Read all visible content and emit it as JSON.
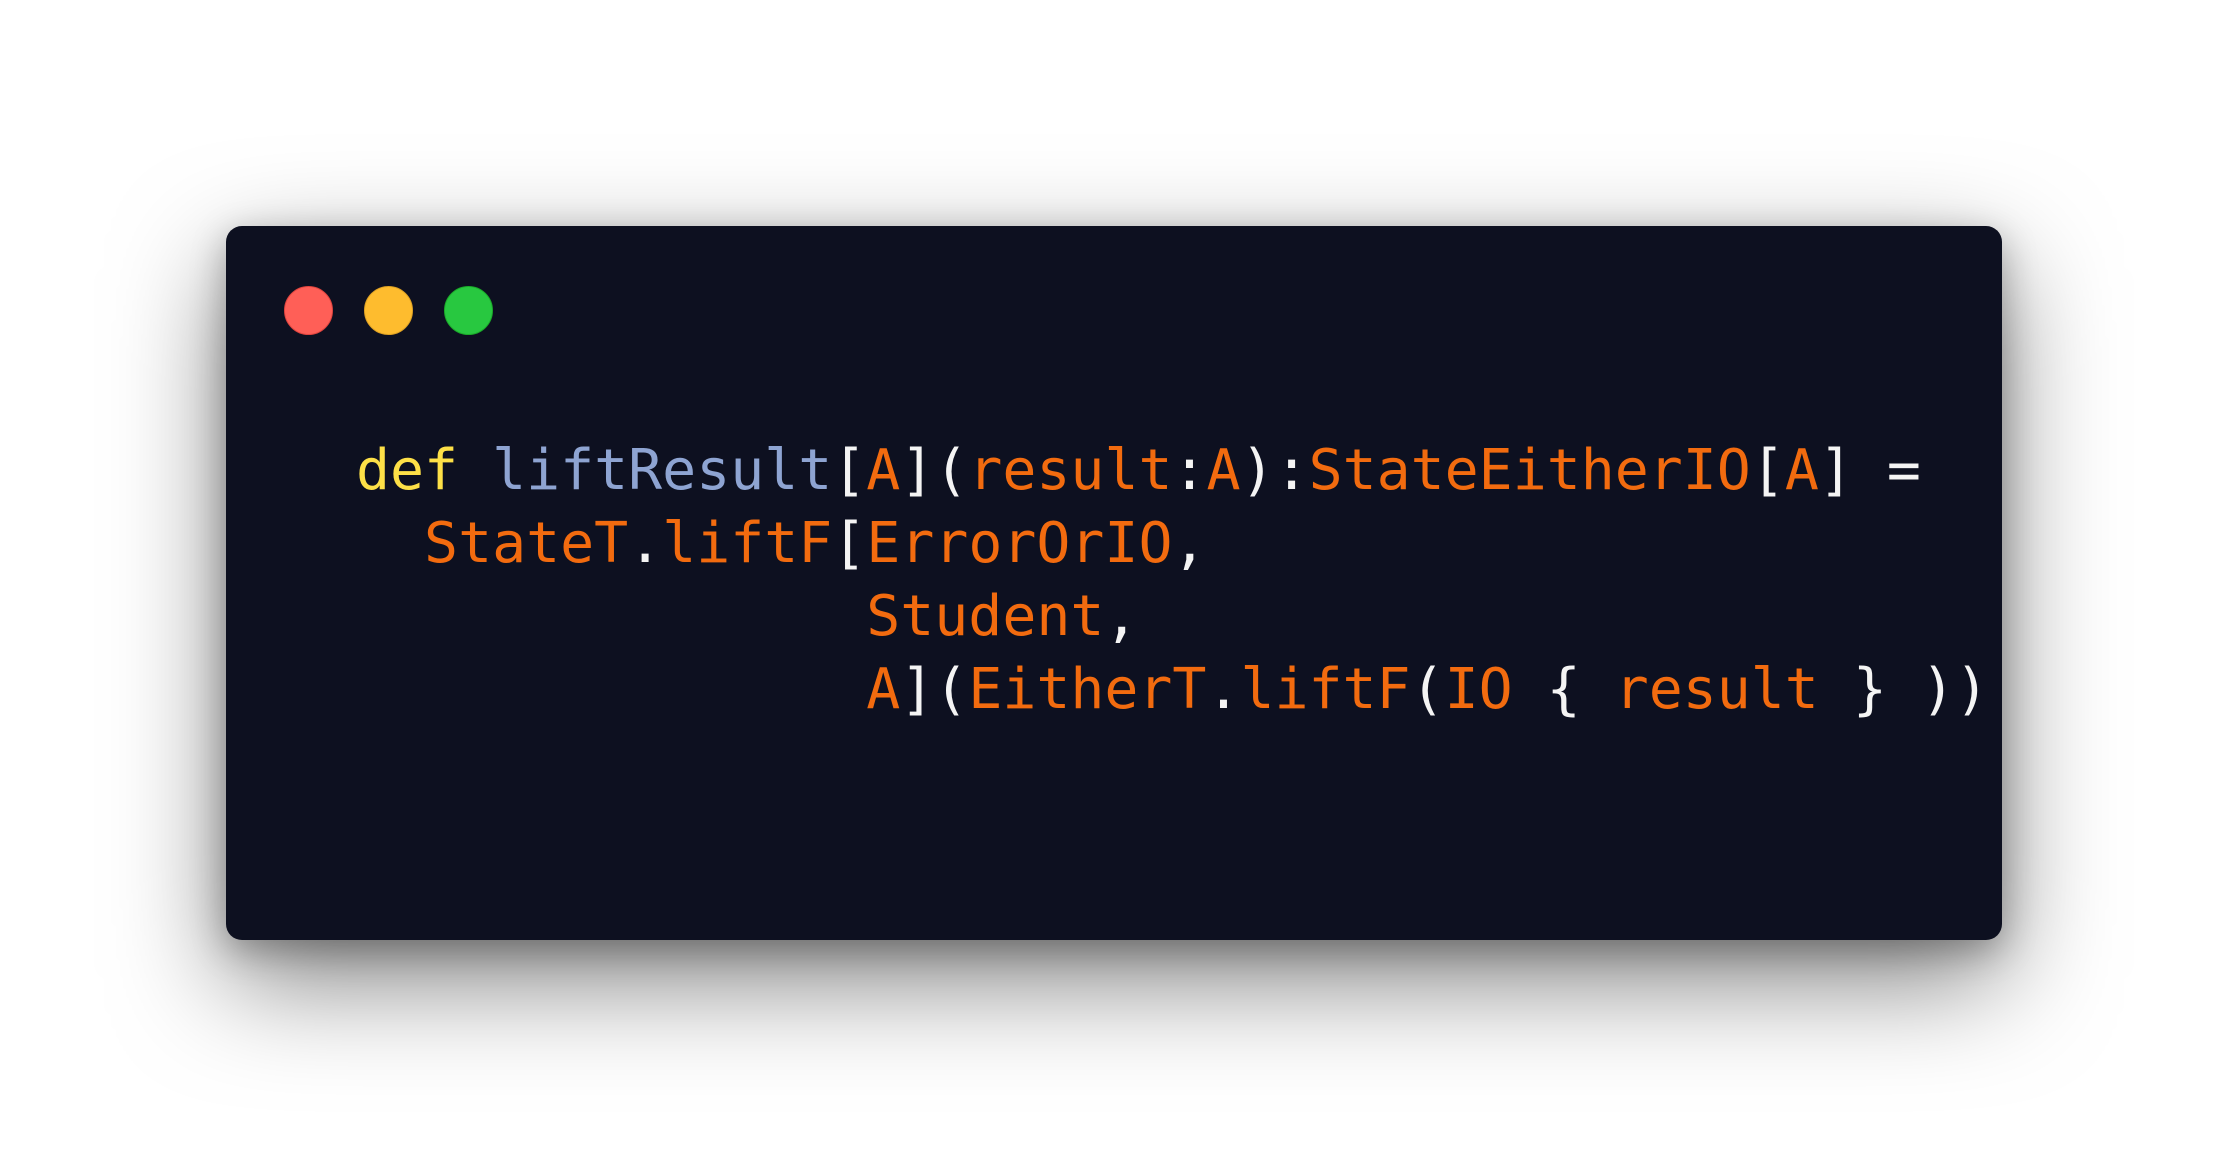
{
  "window": {
    "controls": [
      {
        "name": "close",
        "color": "#ff5f57"
      },
      {
        "name": "minimize",
        "color": "#febc2e"
      },
      {
        "name": "zoom",
        "color": "#28c840"
      }
    ]
  },
  "colors": {
    "background": "#0d1020",
    "keyword": "#fde047",
    "function": "#8ea4d2",
    "type": "#f26b0f",
    "punctuation": "#f4f4f4"
  },
  "code": {
    "language": "scala",
    "lines": [
      [
        {
          "t": "def",
          "k": "keyword"
        },
        {
          "t": " ",
          "k": "punctuation"
        },
        {
          "t": "liftResult",
          "k": "function"
        },
        {
          "t": "[",
          "k": "punctuation"
        },
        {
          "t": "A",
          "k": "type"
        },
        {
          "t": "](",
          "k": "punctuation"
        },
        {
          "t": "result",
          "k": "type"
        },
        {
          "t": ":",
          "k": "punctuation"
        },
        {
          "t": "A",
          "k": "type"
        },
        {
          "t": "):",
          "k": "punctuation"
        },
        {
          "t": "StateEitherIO",
          "k": "type"
        },
        {
          "t": "[",
          "k": "punctuation"
        },
        {
          "t": "A",
          "k": "type"
        },
        {
          "t": "] =",
          "k": "punctuation"
        }
      ],
      [
        {
          "t": "  ",
          "k": "punctuation"
        },
        {
          "t": "StateT",
          "k": "type"
        },
        {
          "t": ".",
          "k": "punctuation"
        },
        {
          "t": "liftF",
          "k": "type"
        },
        {
          "t": "[",
          "k": "punctuation"
        },
        {
          "t": "ErrorOrIO",
          "k": "type"
        },
        {
          "t": ",",
          "k": "punctuation"
        }
      ],
      [
        {
          "t": "               ",
          "k": "punctuation"
        },
        {
          "t": "Student",
          "k": "type"
        },
        {
          "t": ",",
          "k": "punctuation"
        }
      ],
      [
        {
          "t": "               ",
          "k": "punctuation"
        },
        {
          "t": "A",
          "k": "type"
        },
        {
          "t": "](",
          "k": "punctuation"
        },
        {
          "t": "EitherT",
          "k": "type"
        },
        {
          "t": ".",
          "k": "punctuation"
        },
        {
          "t": "liftF",
          "k": "type"
        },
        {
          "t": "(",
          "k": "punctuation"
        },
        {
          "t": "IO",
          "k": "type"
        },
        {
          "t": " { ",
          "k": "punctuation"
        },
        {
          "t": "result",
          "k": "type"
        },
        {
          "t": " } ))",
          "k": "punctuation"
        }
      ]
    ]
  }
}
